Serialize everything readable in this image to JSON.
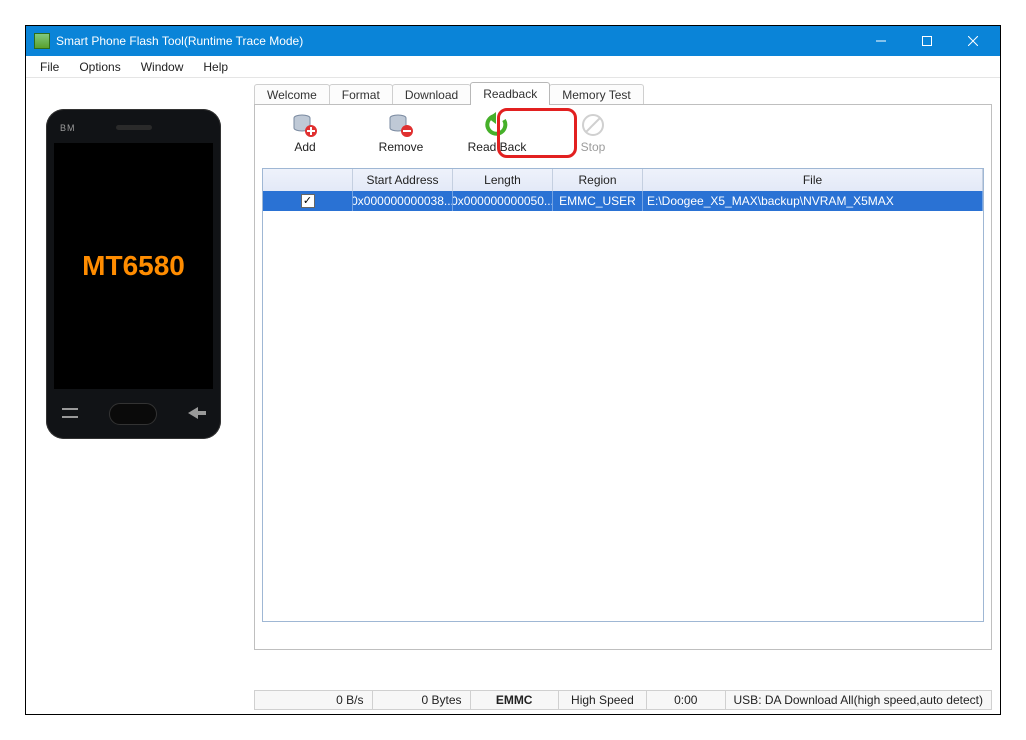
{
  "window": {
    "title": "Smart Phone Flash Tool(Runtime Trace Mode)"
  },
  "menu": {
    "file": "File",
    "options": "Options",
    "window": "Window",
    "help": "Help"
  },
  "phone": {
    "brand": "BM",
    "chip_label": "MT6580"
  },
  "tabs": {
    "welcome": "Welcome",
    "format": "Format",
    "download": "Download",
    "readback": "Readback",
    "memory_test": "Memory Test",
    "active": "Readback"
  },
  "toolbar": {
    "add_label": "Add",
    "remove_label": "Remove",
    "readback_label": "Read Back",
    "stop_label": "Stop"
  },
  "grid": {
    "headers": {
      "check": "",
      "start": "Start Address",
      "length": "Length",
      "region": "Region",
      "file": "File"
    },
    "rows": [
      {
        "checked": true,
        "start": "0x000000000038...",
        "length": "0x000000000050...",
        "region": "EMMC_USER",
        "file": "E:\\Doogee_X5_MAX\\backup\\NVRAM_X5MAX"
      }
    ]
  },
  "status": {
    "speed": "0 B/s",
    "bytes": "0 Bytes",
    "storage": "EMMC",
    "mode": "High Speed",
    "time": "0:00",
    "usb": "USB: DA Download All(high speed,auto detect)"
  }
}
